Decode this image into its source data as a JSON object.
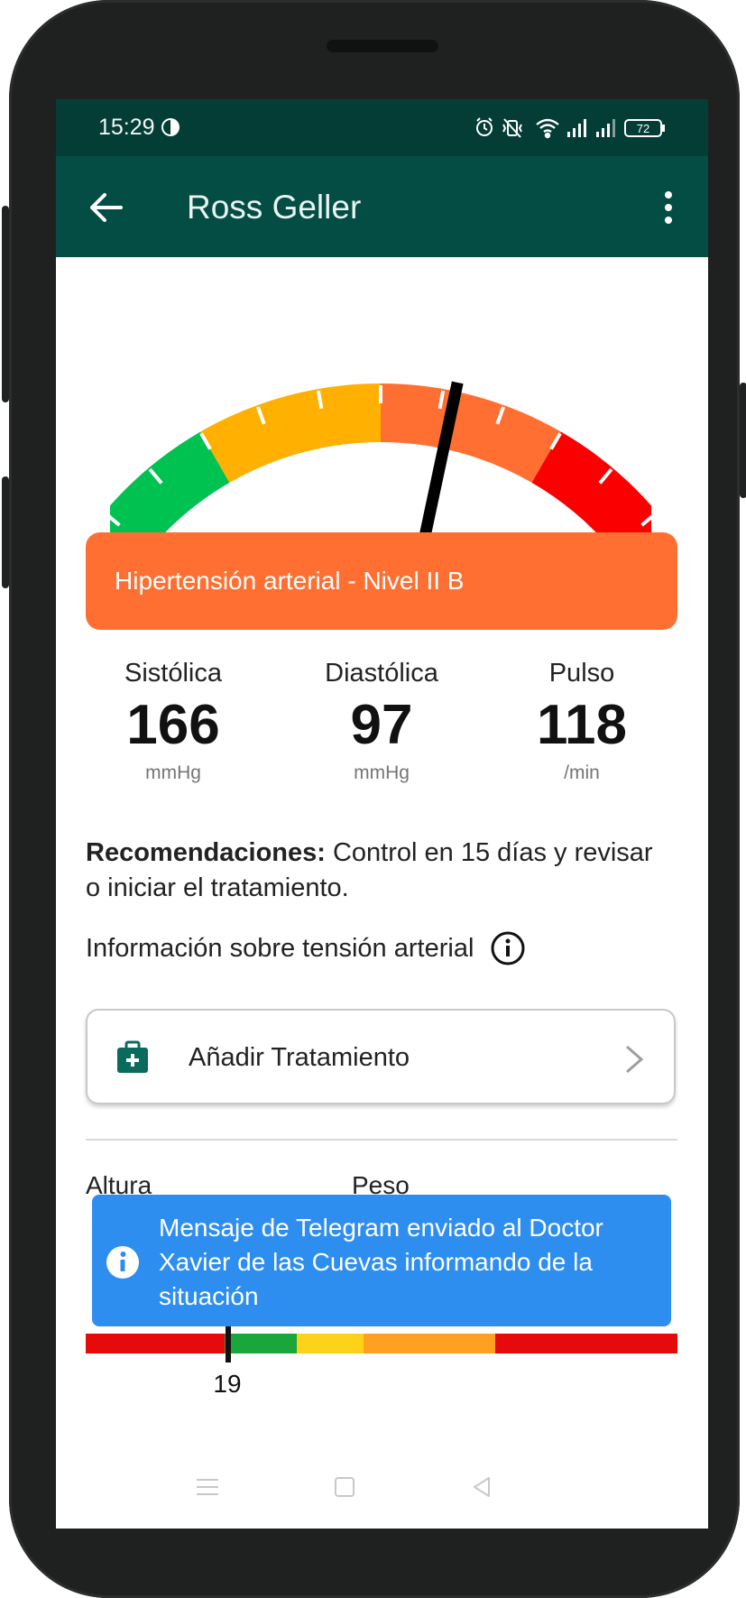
{
  "status_bar": {
    "time": "15:29",
    "battery": "72"
  },
  "app_bar": {
    "title": "Ross Geller",
    "back_icon": "arrow-left-icon",
    "menu_icon": "more-vertical-icon"
  },
  "gauge": {
    "needle_level_fraction": 0.6,
    "segments": [
      {
        "name": "green",
        "color": "#00c251"
      },
      {
        "name": "yellow",
        "color": "#ffb000"
      },
      {
        "name": "orange",
        "color": "#ff6f32"
      },
      {
        "name": "red",
        "color": "#fb0000"
      }
    ]
  },
  "level_banner": {
    "text": "Hipertensión arterial - Nivel II B",
    "color": "#ff6f32"
  },
  "metrics": [
    {
      "label": "Sistólica",
      "value": "166",
      "unit": "mmHg"
    },
    {
      "label": "Diastólica",
      "value": "97",
      "unit": "mmHg"
    },
    {
      "label": "Pulso",
      "value": "118",
      "unit": "/min"
    }
  ],
  "recommendations": {
    "label": "Recomendaciones:",
    "text": " Control en 15 días y revisar o iniciar el tratamiento."
  },
  "info": {
    "text": "Información sobre tensión arterial",
    "icon": "info-circle-icon"
  },
  "treatment_card": {
    "label": "Añadir Tratamiento",
    "icon": "medical-kit-icon",
    "chevron": "chevron-right-icon"
  },
  "fields": {
    "height_label": "Altura",
    "weight_label": "Peso"
  },
  "toast": {
    "message": "Mensaje de Telegram enviado al Doctor Xavier de las Cuevas informando de la situación",
    "color": "#2e8ef0"
  },
  "bmi": {
    "value": "19",
    "segments": [
      {
        "color": "#e60a0a"
      },
      {
        "color": "#1aa63a"
      },
      {
        "color": "#ffd21a"
      },
      {
        "color": "#ffa020"
      },
      {
        "color": "#e60a0a"
      }
    ]
  },
  "navigation_bar": {
    "icons": [
      "menu-icon",
      "home-square-icon",
      "back-triangle-icon"
    ]
  }
}
